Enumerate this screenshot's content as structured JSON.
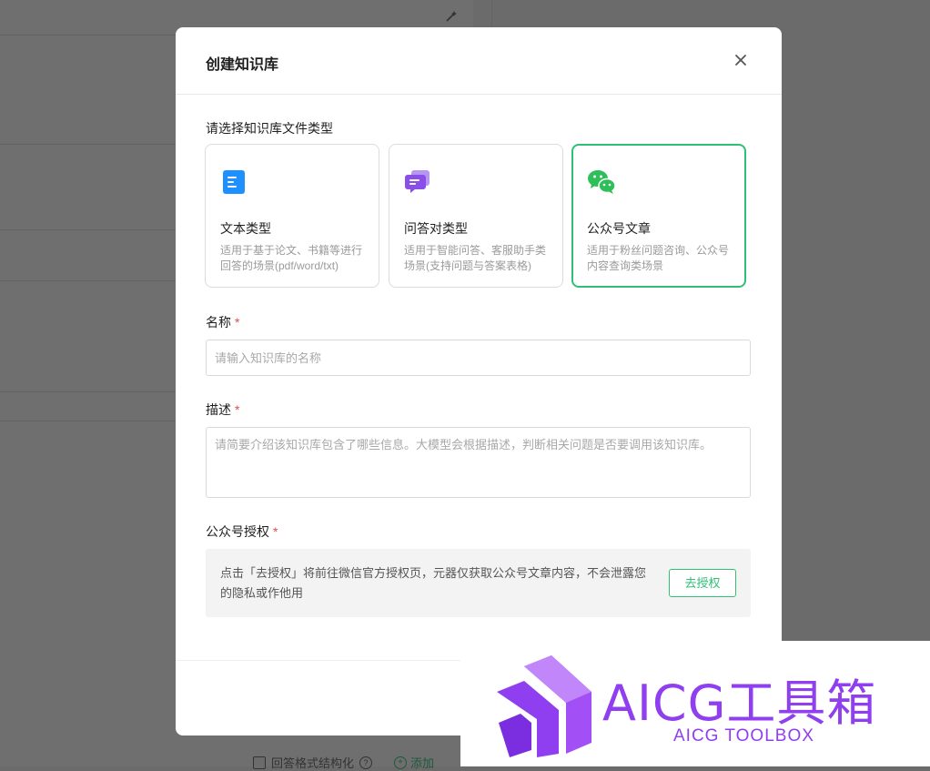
{
  "background": {
    "bottom_checkbox_label": "回答格式结构化",
    "bottom_add_label": "添加"
  },
  "modal": {
    "title": "创建知识库",
    "type_section_label": "请选择知识库文件类型",
    "types": [
      {
        "title": "文本类型",
        "desc": "适用于基于论文、书籍等进行回答的场景(pdf/word/txt)",
        "icon": "document-icon",
        "color": "#1e90ff",
        "selected": false
      },
      {
        "title": "问答对类型",
        "desc": "适用于智能问答、客服助手类场景(支持问题与答案表格)",
        "icon": "chat-bubbles-icon",
        "color": "#8a4fe8",
        "selected": false
      },
      {
        "title": "公众号文章",
        "desc": "适用于粉丝问题咨询、公众号内容查询类场景",
        "icon": "wechat-icon",
        "color": "#2fbf5a",
        "selected": true
      }
    ],
    "name": {
      "label": "名称",
      "required_mark": "*",
      "placeholder": "请输入知识库的名称"
    },
    "description": {
      "label": "描述",
      "required_mark": "*",
      "placeholder": "请简要介绍该知识库包含了哪些信息。大模型会根据描述，判断相关问题是否要调用该知识库。"
    },
    "auth": {
      "label": "公众号授权",
      "required_mark": "*",
      "notice": "点击「去授权」将前往微信官方授权页，元器仅获取公众号文章内容，不会泄露您的隐私或作他用",
      "button": "去授权"
    }
  },
  "watermark": {
    "title": "AICG工具箱",
    "subtitle": "AICG TOOLBOX",
    "color": "#8f3ef0"
  }
}
